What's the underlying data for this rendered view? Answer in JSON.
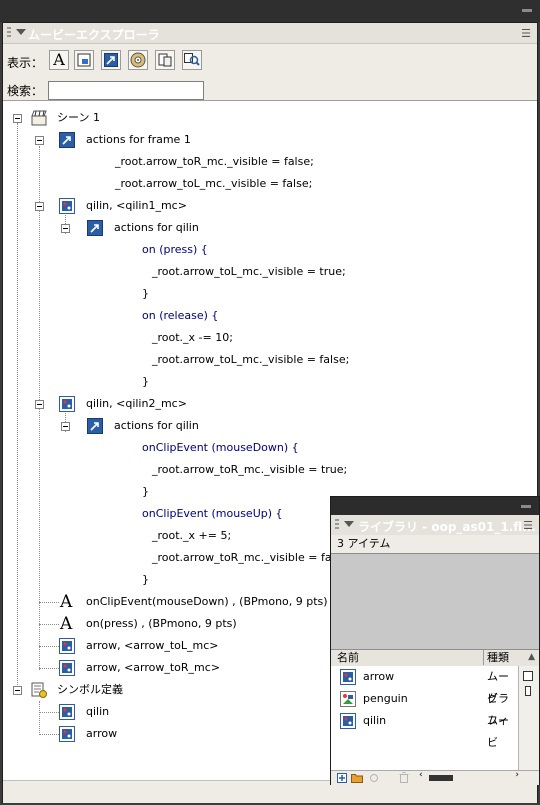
{
  "panel": {
    "title": "ムービーエクスプローラ",
    "menu_glyph": "☰"
  },
  "toolbar": {
    "show_label": "表示：",
    "search_label": "検索：",
    "search_value": "",
    "buttons": [
      "text-filter-icon",
      "button-filter-icon",
      "action-filter-icon",
      "video-filter-icon",
      "frame-filter-icon",
      "customize-filter-icon"
    ]
  },
  "tree": {
    "scene": "シーン 1",
    "actions_frame1": "actions for frame 1",
    "f1_line1": "_root.arrow_toR_mc._visible = false;",
    "f1_line2": "_root.arrow_toL_mc._visible = false;",
    "qilin1": "qilin, <qilin1_mc>",
    "actions_qilin1": "actions for qilin",
    "q1_on_press": "on (press) {",
    "q1_press_body": "_root.arrow_toL_mc._visible = true;",
    "q1_close1": "}",
    "q1_on_release": "on (release) {",
    "q1_release_body1": "_root._x -= 10;",
    "q1_release_body2": "_root.arrow_toL_mc._visible = false;",
    "q1_close2": "}",
    "qilin2": "qilin, <qilin2_mc>",
    "actions_qilin2": "actions for qilin",
    "q2_mousedown": "onClipEvent (mouseDown) {",
    "q2_mousedown_body": "_root.arrow_toR_mc._visible = true;",
    "q2_close1": "}",
    "q2_mouseup": "onClipEvent (mouseUp) {",
    "q2_mouseup_body1": "_root._x += 5;",
    "q2_mouseup_body2": "_root.arrow_toR_mc._visible = false;",
    "q2_close2": "}",
    "text1": "onClipEvent(mouseDown) , (BPmono, 9 pts)",
    "text2": "on(press) , (BPmono, 9 pts)",
    "arrow_tol": "arrow, <arrow_toL_mc>",
    "arrow_tor": "arrow, <arrow_toR_mc>",
    "symbols": "シンボル定義",
    "sym_qilin": "qilin",
    "sym_arrow": "arrow"
  },
  "library": {
    "title": "ライブラリ - oop_as01_1.fl...",
    "count": "3 アイテム",
    "col_name": "名前",
    "col_kind": "種類",
    "sort_glyph": "▲",
    "items": [
      {
        "name": "arrow",
        "kind": "ムービ"
      },
      {
        "name": "penguin",
        "kind": "グラフィ"
      },
      {
        "name": "qilin",
        "kind": "ムービ"
      }
    ]
  }
}
